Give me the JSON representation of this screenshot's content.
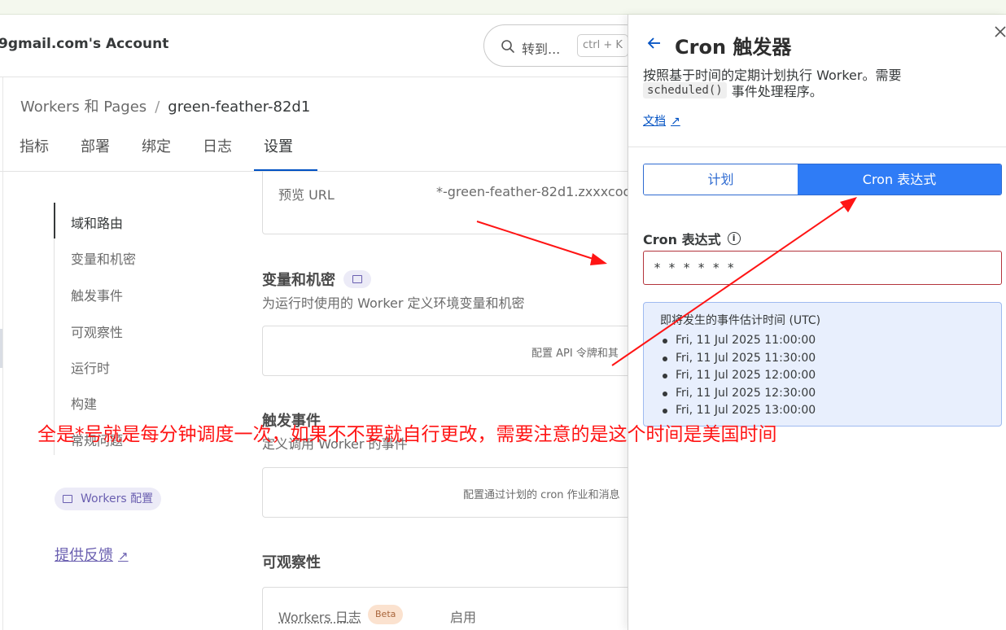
{
  "header": {
    "account": "9gmail.com's Account",
    "search_placeholder": "转到...",
    "search_shortcut": "ctrl + K"
  },
  "breadcrumb": {
    "parent": "Workers 和 Pages",
    "current": "green-feather-82d1"
  },
  "tabs": [
    "指标",
    "部署",
    "绑定",
    "日志",
    "设置"
  ],
  "active_tab": "设置",
  "sidenav": {
    "items": [
      "域和路由",
      "变量和机密",
      "触发事件",
      "可观察性",
      "运行时",
      "构建",
      "常规问题"
    ],
    "config_label": "Workers 配置",
    "feedback": "提供反馈"
  },
  "main": {
    "preview_label": "预览 URL",
    "preview_value": "*-green-feather-82d1.zxxxcoo",
    "vars_title": "变量和机密",
    "vars_desc": "为运行时使用的 Worker 定义环境变量和机密",
    "vars_card_text": "配置 API 令牌和其",
    "triggers_title": "触发事件",
    "triggers_desc": "定义调用 Worker 的事件",
    "triggers_card_text": "配置通过计划的 cron 作业和消息",
    "observability_title": "可观察性",
    "logs_label": "Workers 日志",
    "logs_badge": "Beta",
    "logs_value": "启用"
  },
  "drawer": {
    "title": "Cron 触发器",
    "desc_line1": "按照基于时间的定期计划执行 Worker。需要",
    "desc_code": "scheduled()",
    "desc_line2": "事件处理程序。",
    "docs_link": "文档",
    "seg_options": [
      "计划",
      "Cron 表达式"
    ],
    "seg_selected": "Cron 表达式",
    "cron_label": "Cron 表达式",
    "cron_value": "* * * * * *",
    "upcoming_title": "即将发生的事件估计时间 (UTC)",
    "upcoming_times": [
      "Fri, 11 Jul 2025 11:00:00",
      "Fri, 11 Jul 2025 11:30:00",
      "Fri, 11 Jul 2025 12:00:00",
      "Fri, 11 Jul 2025 12:30:00",
      "Fri, 11 Jul 2025 13:00:00"
    ]
  },
  "annotation": {
    "text": "全是*号就是每分钟调度一次，如果不不要就自行更改，需要注意的是这个时间是美国时间",
    "color": "#ff1414"
  },
  "colors": {
    "accent": "#2f7cf6",
    "link": "#0051c3",
    "purple": "#6a5fb0",
    "error_border": "#b3343c"
  }
}
